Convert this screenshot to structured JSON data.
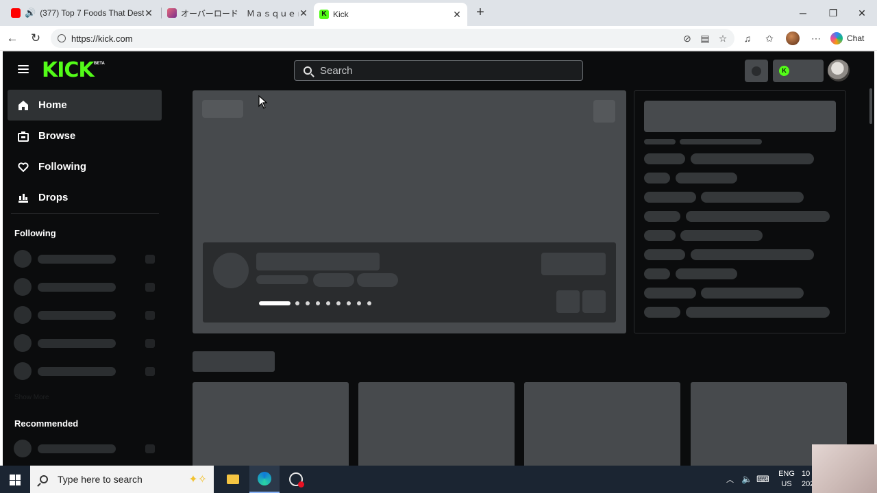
{
  "browser": {
    "tabs": [
      {
        "title": "(377) Top 7 Foods That Destro",
        "favicon": "youtube-icon"
      },
      {
        "title": "オーバーロード　Ｍａｓｑｕｅｒａｄ",
        "favicon": "anime-icon"
      },
      {
        "title": "Kick",
        "favicon": "kick-icon"
      }
    ],
    "new_tab": "+",
    "url": "https://kick.com",
    "chat_label": "Chat"
  },
  "site": {
    "logo": "KICK",
    "logo_badge": "BETA",
    "search_placeholder": "Search",
    "nav": [
      {
        "label": "Home",
        "icon": "home-icon"
      },
      {
        "label": "Browse",
        "icon": "browse-icon"
      },
      {
        "label": "Following",
        "icon": "heart-icon"
      },
      {
        "label": "Drops",
        "icon": "drops-icon"
      }
    ],
    "sidebar_following_title": "Following",
    "show_more": "Show More",
    "sidebar_recommended_title": "Recommended",
    "brand_color": "#53fc18"
  },
  "taskbar": {
    "search_placeholder": "Type here to search",
    "lang_line1": "ENG",
    "lang_line2": "US",
    "clock_line1": "10",
    "clock_line2": "202"
  }
}
